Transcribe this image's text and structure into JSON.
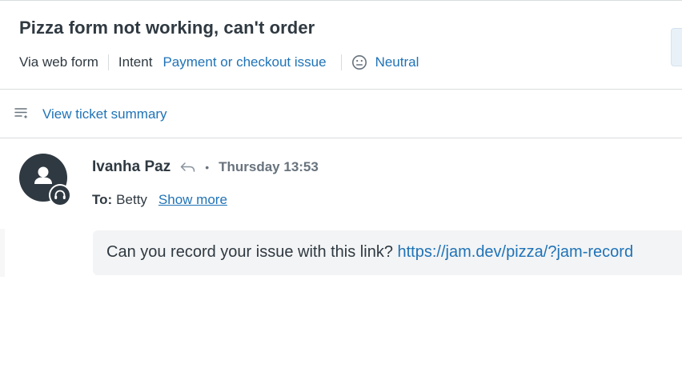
{
  "ticket": {
    "title": "Pizza form not working, can't order",
    "channel": "Via web form",
    "intent_label": "Intent",
    "intent_value": "Payment or checkout issue",
    "sentiment_icon": "neutral-face-icon",
    "sentiment": "Neutral"
  },
  "summary": {
    "icon": "summary-list-icon",
    "label": "View ticket summary"
  },
  "message": {
    "sender": "Ivanha Paz",
    "reply_icon": "reply-arrow-icon",
    "separator": "•",
    "timestamp": "Thursday 13:53",
    "to_label": "To:",
    "to_value": "Betty",
    "show_more": "Show more",
    "body_text": "Can you record your issue with this link? ",
    "body_link": "https://jam.dev/pizza/?jam-record"
  },
  "colors": {
    "link": "#1f73b7",
    "text": "#2f3941",
    "muted": "#68737d",
    "avatar": "#2f3941",
    "bubble": "#f3f4f5",
    "border": "#d8dcde"
  }
}
